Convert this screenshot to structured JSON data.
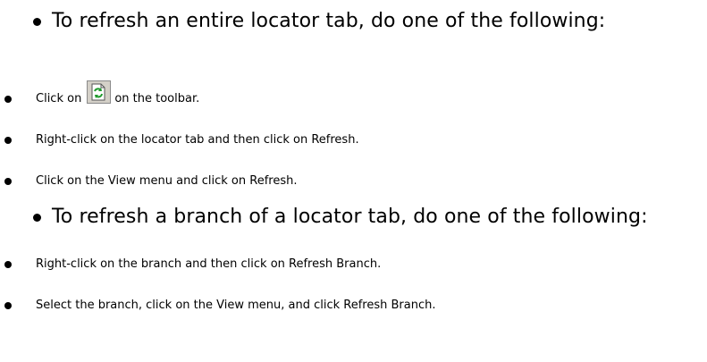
{
  "section1": {
    "heading": "To refresh an entire locator tab, do one of the following:",
    "items": [
      {
        "before": "Click on",
        "icon": "refresh-icon",
        "after": "on the toolbar."
      },
      {
        "text": "Right-click on the locator tab and then click on Refresh."
      },
      {
        "text": "Click on the View menu and click on Refresh."
      }
    ]
  },
  "section2": {
    "heading": "To refresh a branch of a locator tab, do one of the following:",
    "items": [
      {
        "text": "Right-click on the branch and then click on Refresh Branch."
      },
      {
        "text": "Select the branch, click on the View menu, and click Refresh Branch."
      }
    ]
  },
  "colors": {
    "text": "#000000",
    "background": "#ffffff",
    "icon_arrow": "#1e9a2c",
    "icon_page": "#ffffff",
    "icon_button": "#d4d0c8"
  }
}
